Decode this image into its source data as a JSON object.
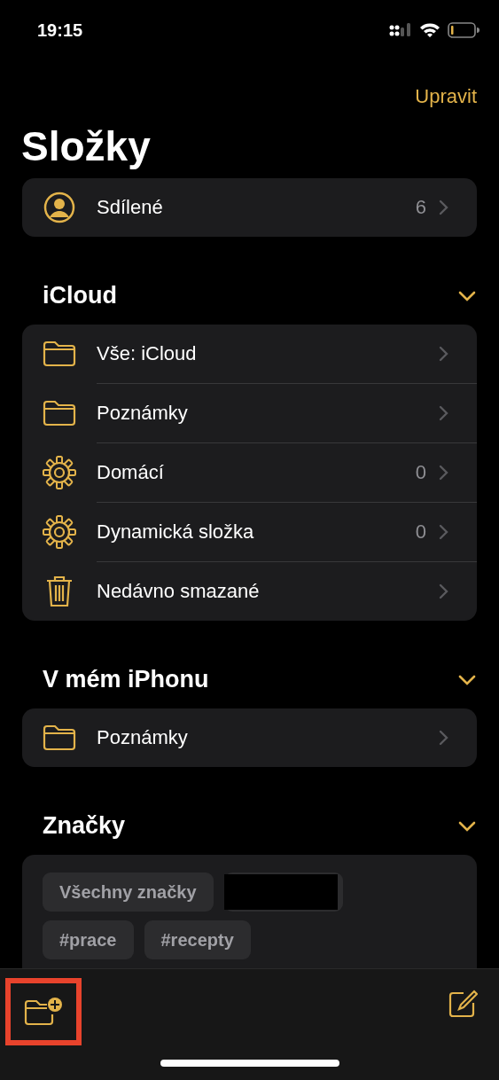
{
  "status_bar": {
    "time": "19:15"
  },
  "nav": {
    "edit_label": "Upravit"
  },
  "title": "Složky",
  "shared": {
    "kind": "person",
    "label": "Sdílené",
    "count": "6"
  },
  "sections": [
    {
      "title": "iCloud",
      "expanded": true,
      "items": [
        {
          "kind": "folder",
          "label": "Vše: iCloud"
        },
        {
          "kind": "folder",
          "label": "Poznámky"
        },
        {
          "kind": "smart",
          "label": "Domácí",
          "count": "0"
        },
        {
          "kind": "smart",
          "label": "Dynamická složka",
          "count": "0"
        },
        {
          "kind": "deleted",
          "label": "Nedávno smazané"
        }
      ]
    },
    {
      "title": "V mém iPhonu",
      "expanded": true,
      "items": [
        {
          "kind": "folder",
          "label": "Poznámky"
        }
      ]
    }
  ],
  "tags": {
    "title": "Značky",
    "expanded": true,
    "items": [
      {
        "kind": "tag",
        "label": "Všechny značky"
      },
      {
        "kind": "redacted"
      },
      {
        "kind": "tag",
        "label": "#prace"
      },
      {
        "kind": "tag",
        "label": "#recepty"
      }
    ]
  },
  "toolbar": {
    "new_folder_highlighted": true
  }
}
